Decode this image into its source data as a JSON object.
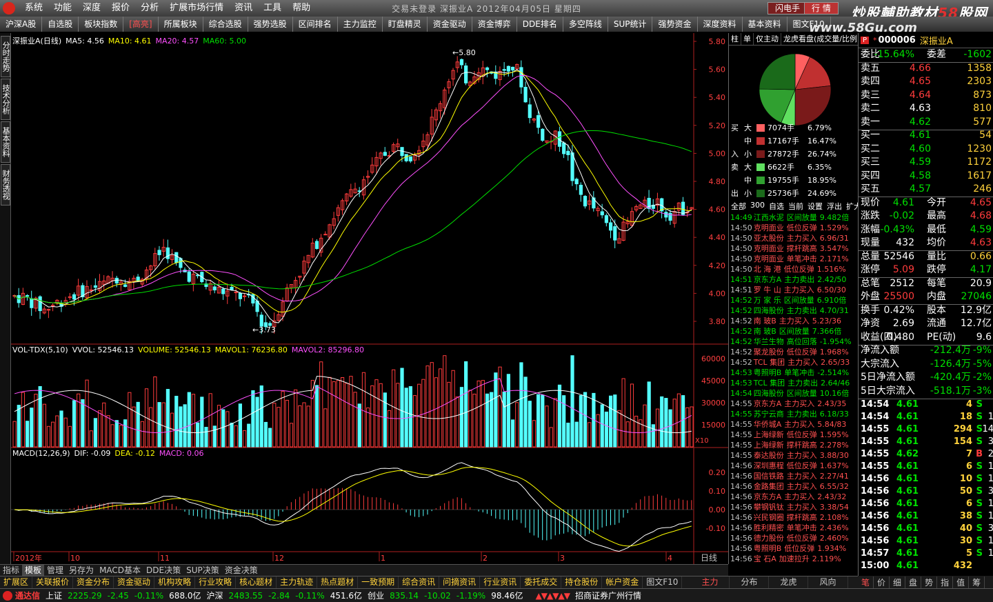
{
  "window": {
    "title": "交易未登录  深振业A 2012年04月05日 星期四",
    "logo_name": "tdx-logo",
    "menu": [
      "系统",
      "功能",
      "深度",
      "报价",
      "分析",
      "扩展市场行情",
      "资讯",
      "工具",
      "帮助"
    ],
    "btn_flash": "闪电手",
    "btn_trade": "行 情"
  },
  "watermark": {
    "text_a": "炒股輔助教材",
    "text_b": "58",
    "text_c": "股网",
    "url": "www.58Gu.com"
  },
  "toolbar": [
    "沪深A股",
    "自选股",
    "板块指数",
    "[高亮]",
    "所属板块",
    "综合选股",
    "强势选股",
    "区间排名",
    "主力监控",
    "盯盘精灵",
    "资金驱动",
    "资金博弈",
    "DDE排名",
    "多空阵线",
    "SUP统计",
    "强势资金",
    "深度资料",
    "基本资料",
    "图文F10"
  ],
  "toolbar_active": 3,
  "left_tabs": [
    "分时走势",
    "技术分析",
    "基本资料",
    "财务透视"
  ],
  "chart": {
    "title": "深振业A(日线)",
    "ma": [
      {
        "label": "MA5: 4.56",
        "color": "#ffffff"
      },
      {
        "label": "MA10: 4.61",
        "color": "#ffff00"
      },
      {
        "label": "MA20: 4.57",
        "color": "#ff50ff"
      },
      {
        "label": "MA60: 5.00",
        "color": "#00e000"
      }
    ],
    "price_axis": [
      "5.80",
      "5.60",
      "5.40",
      "5.20",
      "5.00",
      "4.80",
      "4.60",
      "4.40",
      "4.20",
      "4.00",
      "3.80"
    ],
    "high_label": "5.80",
    "low_label": "3.73",
    "vol_title": "VOL-TDX(5,10)",
    "vol_items": [
      {
        "label": "VVOL: 52546.13",
        "color": "#ffffff"
      },
      {
        "label": "VOLUME: 52546.13",
        "color": "#ffff00"
      },
      {
        "label": "MAVOL1: 76236.80",
        "color": "#ffff00"
      },
      {
        "label": "MAVOL2: 85296.80",
        "color": "#ff50ff"
      }
    ],
    "vol_axis": [
      "60000",
      "45000",
      "30000",
      "15000"
    ],
    "vol_unit": "X10",
    "macd_title": "MACD(12,26,9)",
    "macd_items": [
      {
        "label": "DIF: -0.09",
        "color": "#ffffff"
      },
      {
        "label": "DEA: -0.12",
        "color": "#ffff00"
      },
      {
        "label": "MACD: 0.06",
        "color": "#ff50ff"
      }
    ],
    "macd_axis": [
      "0.20",
      "0.10",
      "0.00",
      "-0.10"
    ],
    "date_axis": [
      "2012年",
      "10",
      "11",
      "12",
      "1",
      "2",
      "3",
      "4"
    ],
    "date_footer": "日线"
  },
  "bottom_tabs1": [
    "指标",
    "模板",
    "管理",
    "另存为",
    "MACD基本",
    "DDE决策",
    "SUP决策",
    "资金决策"
  ],
  "bottom_tabs1_on": 1,
  "bottom_tabs2": [
    "扩展区",
    "关联报价",
    "资金分布",
    "资金驱动",
    "机构攻略",
    "行业攻略",
    "核心题材",
    "主力轨迹",
    "热点题材",
    "一致预期",
    "综合资讯",
    "问摘资讯",
    "行业资讯",
    "委托成交",
    "持仓股份",
    "帐户资金",
    "图文F10"
  ],
  "bottom_tabs2b": [
    "主力",
    "分布",
    "龙虎",
    "风向"
  ],
  "status": {
    "brand": "通达信",
    "sh_label": "上证",
    "sh_val": "2225.29",
    "sh_chg": "-2.45",
    "sh_pct": "-0.11%",
    "sh_amt": "688.0亿",
    "hs_label": "沪深",
    "hs_val": "2483.55",
    "hs_chg": "-2.84",
    "hs_pct": "-0.11%",
    "hs_amt": "451.6亿",
    "cy_label": "创业",
    "cy_val": "835.14",
    "cy_chg": "-10.02",
    "cy_pct": "-1.19%",
    "cy_amt": "98.46亿",
    "broker": "招商证券广州行情"
  },
  "flow_panel": {
    "tabs": [
      "柱",
      "单",
      "仅主动",
      "龙虎看盘(成交量/比例)"
    ],
    "pie": [
      6.79,
      16.47,
      26.74,
      6.35,
      18.95,
      24.69
    ],
    "rows": [
      {
        "side": "买",
        "size": "大",
        "vol": "7074手",
        "pct": "6.79%",
        "color": "#ff6060"
      },
      {
        "side": "",
        "size": "中",
        "vol": "17167手",
        "pct": "16.47%",
        "color": "#c03030"
      },
      {
        "side": "入",
        "size": "小",
        "vol": "27872手",
        "pct": "26.74%",
        "color": "#7a1a1a"
      },
      {
        "side": "卖",
        "size": "大",
        "vol": "6622手",
        "pct": "6.35%",
        "color": "#60e060"
      },
      {
        "side": "",
        "size": "中",
        "vol": "19755手",
        "pct": "18.95%",
        "color": "#30a030"
      },
      {
        "side": "出",
        "size": "小",
        "vol": "25736手",
        "pct": "24.69%",
        "color": "#1a6a1a"
      }
    ],
    "filter": [
      "全部",
      "300",
      "自选",
      "当前",
      "设置",
      "浮出",
      "扩大"
    ],
    "events": [
      {
        "t": "14:49",
        "n": "江西水泥",
        "k": "区间放量",
        "v": "9.482倍",
        "g": true
      },
      {
        "t": "14:50",
        "n": "克明面业",
        "k": "低位反弹",
        "v": "1.529%",
        "g": false
      },
      {
        "t": "14:50",
        "n": "亚太股份",
        "k": "主力买入",
        "v": "6.96/31",
        "g": false
      },
      {
        "t": "14:50",
        "n": "克明面业",
        "k": "撑杆跳高",
        "v": "3.547%",
        "g": false
      },
      {
        "t": "14:50",
        "n": "克明面业",
        "k": "单笔冲击",
        "v": "2.171%",
        "g": false
      },
      {
        "t": "14:50",
        "n": "北 海 港",
        "k": "低位反弹",
        "v": "1.516%",
        "g": false
      },
      {
        "t": "14:51",
        "n": "京东方A",
        "k": "主力卖出",
        "v": "2.42/50",
        "g": true
      },
      {
        "t": "14:51",
        "n": "罗 牛 山",
        "k": "主力买入",
        "v": "6.50/30",
        "g": false
      },
      {
        "t": "14:52",
        "n": "万 家 乐",
        "k": "区间放量",
        "v": "6.910倍",
        "g": true
      },
      {
        "t": "14:52",
        "n": "四海股份",
        "k": "主力卖出",
        "v": "4.70/31",
        "g": true
      },
      {
        "t": "14:52",
        "n": "南 玻B",
        "k": "主力买入",
        "v": "5.23/36",
        "g": false
      },
      {
        "t": "14:52",
        "n": "南 玻B",
        "k": "区间放量",
        "v": "7.366倍",
        "g": true
      },
      {
        "t": "14:52",
        "n": "华兰生物",
        "k": "高位回落",
        "v": "-1.954%",
        "g": true
      },
      {
        "t": "14:52",
        "n": "聚龙股份",
        "k": "低位反弹",
        "v": "1.968%",
        "g": false
      },
      {
        "t": "14:52",
        "n": "TCL 集团",
        "k": "主力买入",
        "v": "2.65/33",
        "g": false
      },
      {
        "t": "14:53",
        "n": "粤照明B",
        "k": "单笔冲击",
        "v": "-2.514%",
        "g": true
      },
      {
        "t": "14:53",
        "n": "TCL 集团",
        "k": "主力卖出",
        "v": "2.64/46",
        "g": true
      },
      {
        "t": "14:54",
        "n": "四海股份",
        "k": "区间放量",
        "v": "10.16倍",
        "g": true
      },
      {
        "t": "14:55",
        "n": "京东方A",
        "k": "主力买入",
        "v": "2.43/35",
        "g": false
      },
      {
        "t": "14:55",
        "n": "苏宁云商",
        "k": "主力卖出",
        "v": "6.18/33",
        "g": true
      },
      {
        "t": "14:55",
        "n": "华侨城A",
        "k": "主力买入",
        "v": "5.84/83",
        "g": false
      },
      {
        "t": "14:55",
        "n": "上海绿新",
        "k": "低位反弹",
        "v": "1.595%",
        "g": false
      },
      {
        "t": "14:55",
        "n": "上海绿新",
        "k": "撑杆跳高",
        "v": "2.278%",
        "g": false
      },
      {
        "t": "14:55",
        "n": "泰达股份",
        "k": "主力买入",
        "v": "3.88/30",
        "g": false
      },
      {
        "t": "14:56",
        "n": "深圳惠程",
        "k": "低位反弹",
        "v": "1.637%",
        "g": false
      },
      {
        "t": "14:56",
        "n": "国信铁路",
        "k": "主力买入",
        "v": "2.27/41",
        "g": false
      },
      {
        "t": "14:56",
        "n": "金路集团",
        "k": "主力买入",
        "v": "6.55/32",
        "g": false
      },
      {
        "t": "14:56",
        "n": "京东方A",
        "k": "主力买入",
        "v": "2.43/32",
        "g": false
      },
      {
        "t": "14:56",
        "n": "攀钢钒钛",
        "k": "主力买入",
        "v": "3.38/54",
        "g": false
      },
      {
        "t": "14:56",
        "n": "兴民钢圈",
        "k": "撑杆跳高",
        "v": "2.108%",
        "g": false
      },
      {
        "t": "14:56",
        "n": "胜利精密",
        "k": "单笔冲击",
        "v": "2.436%",
        "g": false
      },
      {
        "t": "14:56",
        "n": "德力股份",
        "k": "低位反弹",
        "v": "2.460%",
        "g": false
      },
      {
        "t": "14:56",
        "n": "粤照明B",
        "k": "低位反弹",
        "v": "1.934%",
        "g": false
      },
      {
        "t": "14:56",
        "n": "宝 石A",
        "k": "加速拉升",
        "v": "2.119%",
        "g": false
      }
    ]
  },
  "quote": {
    "code": "000006",
    "name": "深振业A",
    "weibi_label": "委比",
    "weibi": "-15.64%",
    "weicha_label": "委差",
    "weicha": "-1602",
    "asks": [
      {
        "label": "卖五",
        "price": "4.66",
        "vol": "1358",
        "pc": "red"
      },
      {
        "label": "卖四",
        "price": "4.65",
        "vol": "2303",
        "pc": "red"
      },
      {
        "label": "卖三",
        "price": "4.64",
        "vol": "873",
        "pc": "red"
      },
      {
        "label": "卖二",
        "price": "4.63",
        "vol": "810",
        "pc": "wht"
      },
      {
        "label": "卖一",
        "price": "4.62",
        "vol": "577",
        "pc": "grn"
      }
    ],
    "bids": [
      {
        "label": "买一",
        "price": "4.61",
        "vol": "54",
        "pc": "grn"
      },
      {
        "label": "买二",
        "price": "4.60",
        "vol": "1230",
        "pc": "grn"
      },
      {
        "label": "买三",
        "price": "4.59",
        "vol": "1172",
        "pc": "grn"
      },
      {
        "label": "买四",
        "price": "4.58",
        "vol": "1617",
        "pc": "grn"
      },
      {
        "label": "买五",
        "price": "4.57",
        "vol": "246",
        "pc": "grn"
      }
    ],
    "stats": [
      {
        "l1": "现价",
        "v1": "4.61",
        "c1": "grn",
        "l2": "今开",
        "v2": "4.65",
        "c2": "red"
      },
      {
        "l1": "涨跌",
        "v1": "-0.02",
        "c1": "grn",
        "l2": "最高",
        "v2": "4.68",
        "c2": "red"
      },
      {
        "l1": "涨幅",
        "v1": "-0.43%",
        "c1": "grn",
        "l2": "最低",
        "v2": "4.59",
        "c2": "grn"
      },
      {
        "l1": "现量",
        "v1": "432",
        "c1": "wht",
        "l2": "均价",
        "v2": "4.63",
        "c2": "red"
      }
    ],
    "stats2": [
      {
        "l1": "总量",
        "v1": "52546",
        "c1": "wht",
        "l2": "量比",
        "v2": "0.66",
        "c2": "yel"
      },
      {
        "l1": "涨停",
        "v1": "5.09",
        "c1": "red",
        "l2": "跌停",
        "v2": "4.17",
        "c2": "grn"
      }
    ],
    "stats3": [
      {
        "l1": "总笔",
        "v1": "2512",
        "c1": "wht",
        "l2": "每笔",
        "v2": "20.9",
        "c2": "wht"
      },
      {
        "l1": "外盘",
        "v1": "25500",
        "c1": "red",
        "l2": "内盘",
        "v2": "27046",
        "c2": "grn"
      }
    ],
    "stats4": [
      {
        "l1": "换手",
        "v1": "0.42%",
        "c1": "wht",
        "l2": "股本",
        "v2": "12.9亿",
        "c2": "wht"
      },
      {
        "l1": "净资",
        "v1": "2.69",
        "c1": "wht",
        "l2": "流通",
        "v2": "12.7亿",
        "c2": "wht"
      },
      {
        "l1": "收益(四)",
        "v1": "0.480",
        "c1": "wht",
        "l2": "PE(动)",
        "v2": "9.6",
        "c2": "wht"
      }
    ],
    "flows": [
      {
        "label": "净流入额",
        "val": "-212.4万",
        "pct": "-9%"
      },
      {
        "label": "大宗流入",
        "val": "-126.4万",
        "pct": "-5%"
      },
      {
        "label": "5日净流入额",
        "val": "-420.4万",
        "pct": "-2%"
      },
      {
        "label": "5日大宗流入",
        "val": "-518.1万",
        "pct": "-3%"
      }
    ],
    "ticks": [
      {
        "t": "14:54",
        "p": "4.61",
        "v": "4",
        "bs": "S",
        "c": ""
      },
      {
        "t": "14:54",
        "p": "4.61",
        "v": "18",
        "bs": "S",
        "c": "1"
      },
      {
        "t": "14:55",
        "p": "4.61",
        "v": "294",
        "bs": "S",
        "c": "14"
      },
      {
        "t": "14:55",
        "p": "4.61",
        "v": "154",
        "bs": "S",
        "c": "3"
      },
      {
        "t": "14:55",
        "p": "4.62",
        "v": "7",
        "bs": "B",
        "c": "2"
      },
      {
        "t": "14:55",
        "p": "4.61",
        "v": "6",
        "bs": "S",
        "c": "1"
      },
      {
        "t": "14:56",
        "p": "4.61",
        "v": "10",
        "bs": "S",
        "c": "1"
      },
      {
        "t": "14:56",
        "p": "4.61",
        "v": "50",
        "bs": "S",
        "c": "3"
      },
      {
        "t": "14:56",
        "p": "4.61",
        "v": "6",
        "bs": "S",
        "c": "1"
      },
      {
        "t": "14:56",
        "p": "4.61",
        "v": "38",
        "bs": "S",
        "c": "1"
      },
      {
        "t": "14:56",
        "p": "4.61",
        "v": "40",
        "bs": "S",
        "c": "3"
      },
      {
        "t": "14:56",
        "p": "4.61",
        "v": "30",
        "bs": "S",
        "c": "1"
      },
      {
        "t": "14:57",
        "p": "4.61",
        "v": "5",
        "bs": "S",
        "c": "1"
      },
      {
        "t": "15:00",
        "p": "4.61",
        "v": "432",
        "bs": "",
        "c": ""
      }
    ],
    "foot_tabs": [
      "笔",
      "价",
      "细",
      "盘",
      "势",
      "指",
      "值",
      "筹"
    ]
  }
}
